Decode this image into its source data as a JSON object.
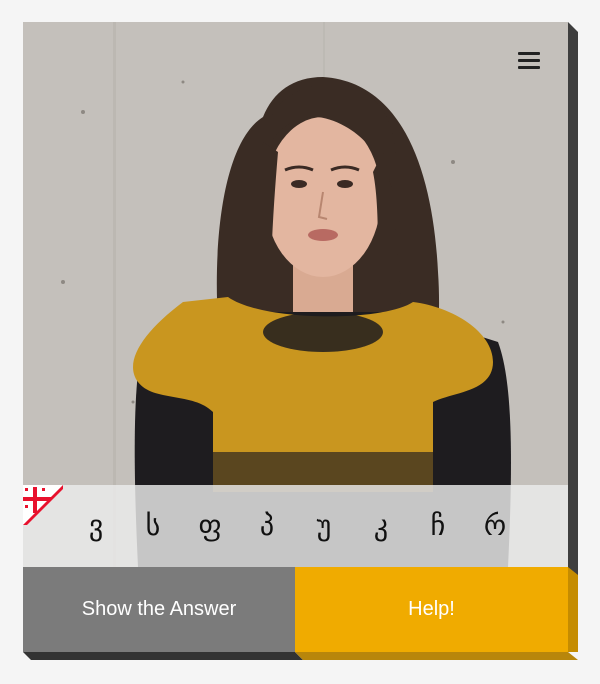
{
  "menu": {
    "icon": "hamburger-menu-icon"
  },
  "flag": {
    "icon": "georgian-flag-icon",
    "colors": [
      "#ffffff",
      "#e8112d"
    ]
  },
  "letters": [
    "ვ",
    "ს",
    "ფ",
    "პ",
    "უ",
    "კ",
    "ჩ",
    "რ"
  ],
  "buttons": {
    "show_answer_label": "Show the Answer",
    "help_label": "Help!"
  },
  "colors": {
    "answer_button": "#7b7b7b",
    "help_button": "#f0ab00",
    "letters_bar": "#ebebeb"
  }
}
